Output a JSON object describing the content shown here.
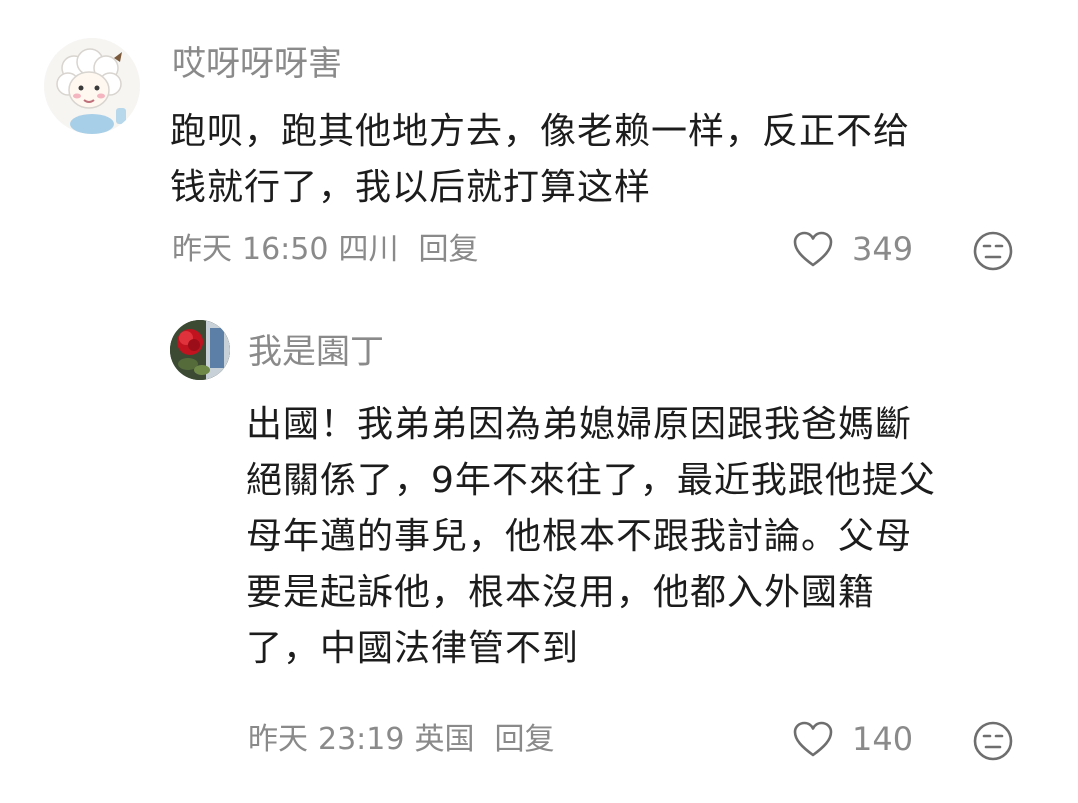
{
  "comments": [
    {
      "username": "哎呀呀呀害",
      "lines": [
        "跑呗，跑其他地方去，像老赖一样，反正不给",
        "钱就行了，我以后就打算这样"
      ],
      "date": "昨天",
      "time": "16:50",
      "location": "四川",
      "reply_label": "回复",
      "likes": "349",
      "avatar_icon": "cartoon-sheep-avatar",
      "reply": {
        "username": "我是園丁",
        "lines": [
          "出國！我弟弟因為弟媳婦原因跟我爸媽斷",
          "絕關係了，9年不來往了，最近我跟他提父",
          "母年邁的事兒，他根本不跟我討論。父母",
          "要是起訴他，根本沒用，他都入外國籍",
          "了，中國法律管不到"
        ],
        "date": "昨天",
        "time": "23:19",
        "location": "英国",
        "reply_label": "回复",
        "likes": "140",
        "avatar_icon": "red-rose-avatar"
      }
    }
  ],
  "colors": {
    "text": "#1c1c1c",
    "muted": "#8a8a8a",
    "background": "#ffffff"
  }
}
